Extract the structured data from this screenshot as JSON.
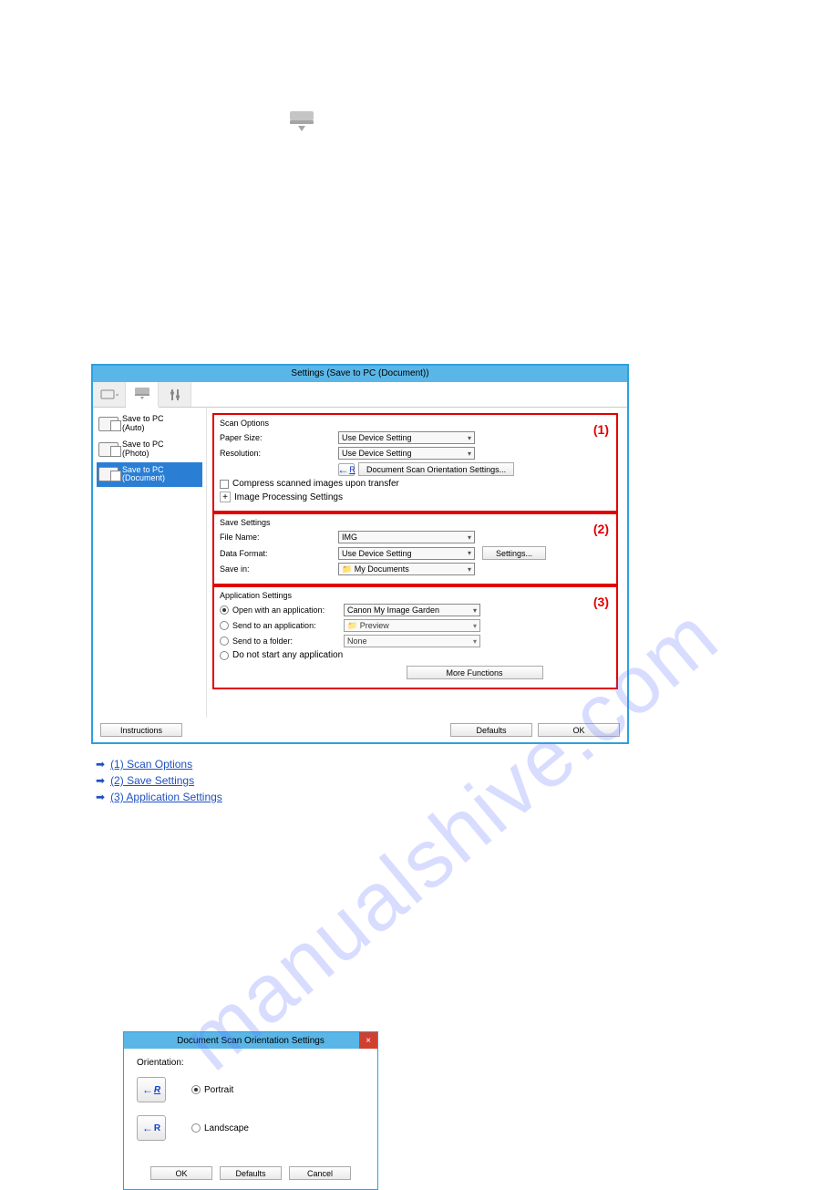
{
  "watermark": "manualshive.com",
  "mainDialog": {
    "title": "Settings (Save to PC (Document))",
    "sidebar": [
      {
        "line1": "Save to PC",
        "line2": "(Auto)"
      },
      {
        "line1": "Save to PC",
        "line2": "(Photo)"
      },
      {
        "line1": "Save to PC",
        "line2": "(Document)"
      }
    ],
    "scanOptions": {
      "heading": "Scan Options",
      "paperSizeLabel": "Paper Size:",
      "paperSizeValue": "Use Device Setting",
      "resolutionLabel": "Resolution:",
      "resolutionValue": "Use Device Setting",
      "orientationBtn": "Document Scan Orientation Settings...",
      "compress": "Compress scanned images upon transfer",
      "imageProc": "Image Processing Settings",
      "secNum": "(1)"
    },
    "saveSettings": {
      "heading": "Save Settings",
      "fileNameLabel": "File Name:",
      "fileNameValue": "IMG",
      "dataFormatLabel": "Data Format:",
      "dataFormatValue": "Use Device Setting",
      "settingsBtn": "Settings...",
      "saveInLabel": "Save in:",
      "saveInValue": "My Documents",
      "secNum": "(2)"
    },
    "appSettings": {
      "heading": "Application Settings",
      "openWithLabel": "Open with an application:",
      "openWithValue": "Canon My Image Garden",
      "sendToAppLabel": "Send to an application:",
      "sendToAppValue": "Preview",
      "sendFolderLabel": "Send to a folder:",
      "sendFolderValue": "None",
      "noStart": "Do not start any application",
      "moreFunctions": "More Functions",
      "secNum": "(3)"
    },
    "footer": {
      "instructions": "Instructions",
      "defaults": "Defaults",
      "ok": "OK"
    }
  },
  "links": {
    "l1": "(1) Scan Options",
    "l2": "(2) Save Settings",
    "l3": "(3) Application Settings"
  },
  "orientDialog": {
    "title": "Document Scan Orientation Settings",
    "heading": "Orientation:",
    "portrait": "Portrait",
    "landscape": "Landscape",
    "ok": "OK",
    "defaults": "Defaults",
    "cancel": "Cancel"
  }
}
